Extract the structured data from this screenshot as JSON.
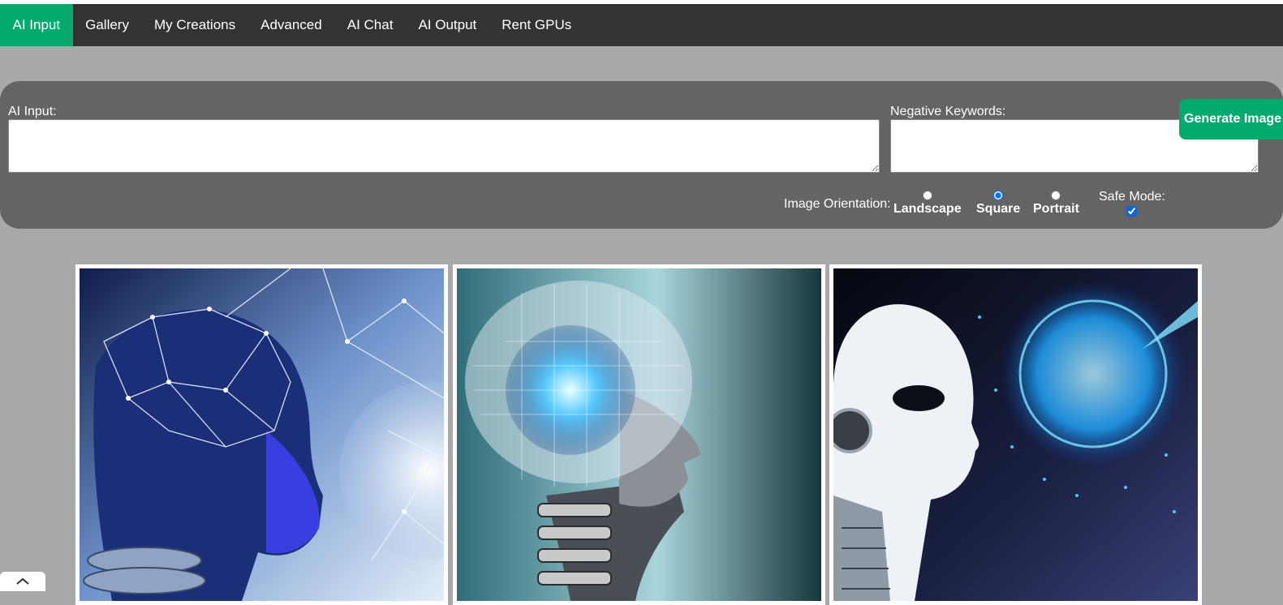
{
  "nav": {
    "items": [
      {
        "label": "AI Input",
        "active": true
      },
      {
        "label": "Gallery"
      },
      {
        "label": "My Creations"
      },
      {
        "label": "Advanced"
      },
      {
        "label": "AI Chat"
      },
      {
        "label": "AI Output"
      },
      {
        "label": "Rent GPUs"
      }
    ]
  },
  "form": {
    "ai_input_label": "AI Input:",
    "ai_input_value": "",
    "negative_label": "Negative Keywords:",
    "negative_value": "",
    "orientation_label": "Image Orientation:",
    "orientations": [
      {
        "label": "Landscape",
        "checked": false
      },
      {
        "label": "Square",
        "checked": true
      },
      {
        "label": "Portrait",
        "checked": false
      }
    ],
    "safe_mode_label": "Safe Mode:",
    "safe_mode_checked": true,
    "generate_label": "Generate Image"
  },
  "gallery": {
    "images": [
      {
        "subject": "robot head with glowing neural network mesh"
      },
      {
        "subject": "robot head with glowing circuit brain"
      },
      {
        "subject": "white humanoid robot facing a glowing particle sphere"
      }
    ]
  },
  "colors": {
    "nav_bg": "#333333",
    "nav_active": "#04aa6d",
    "page_bg": "#a9a9a9",
    "panel_bg": "#646464",
    "button_bg": "#04aa6d"
  },
  "icons": {
    "scroll_top": "chevron-up-icon"
  }
}
